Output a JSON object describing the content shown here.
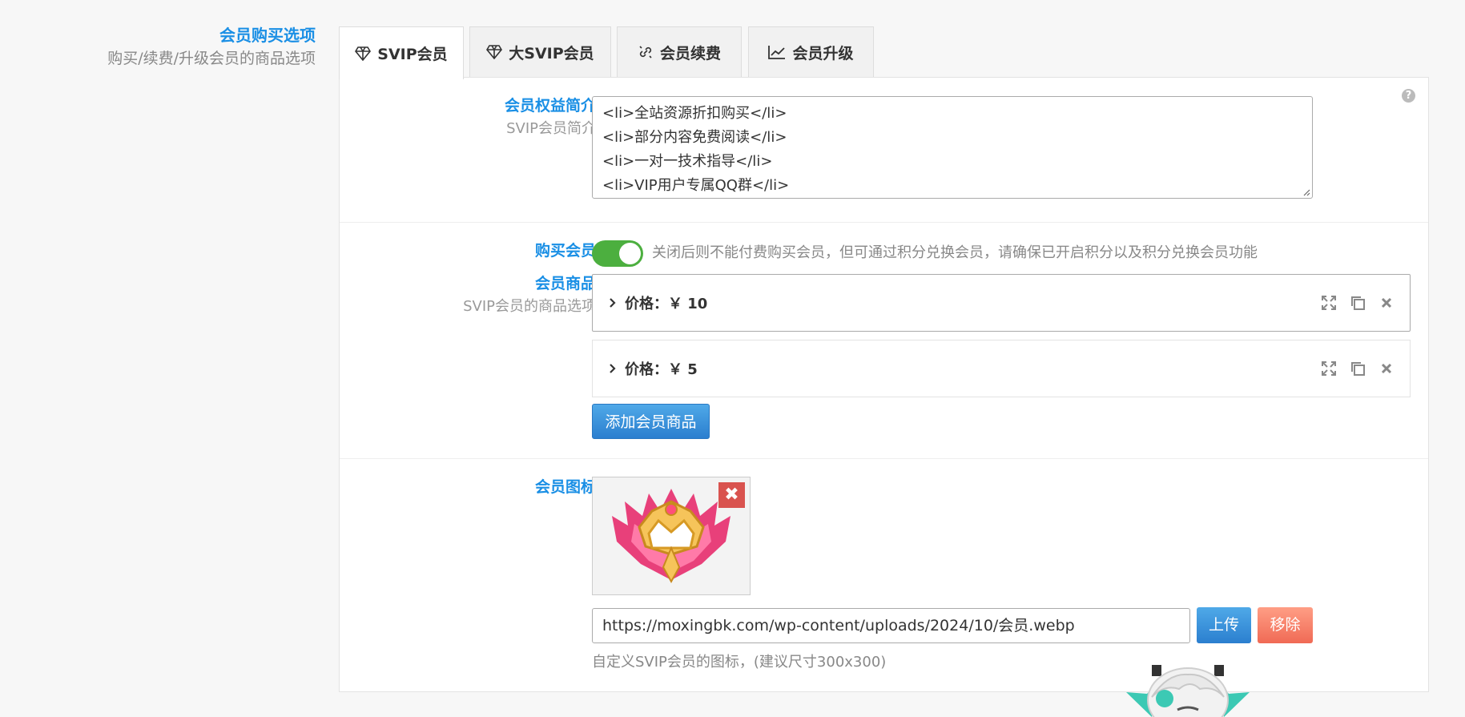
{
  "section": {
    "title": "会员购买选项",
    "subtitle": "购买/续费/升级会员的商品选项"
  },
  "tabs": [
    {
      "label": "SVIP会员",
      "icon": "diamond-icon",
      "active": true
    },
    {
      "label": "大SVIP会员",
      "icon": "diamond-icon",
      "active": false
    },
    {
      "label": "会员续费",
      "icon": "link-icon",
      "active": false
    },
    {
      "label": "会员升级",
      "icon": "chart-line-icon",
      "active": false
    }
  ],
  "benefits": {
    "label": "会员权益简介",
    "sublabel": "SVIP会员简介",
    "lines": [
      "<li>全站资源折扣购买</li>",
      "<li>部分内容免费阅读</li>",
      "<li>一对一技术指导</li>",
      "<li>VIP用户专属QQ群</li>"
    ]
  },
  "purchase": {
    "label": "购买会员",
    "enabled": true,
    "description": "关闭后则不能付费购买会员，但可通过积分兑换会员，请确保已开启积分以及积分兑换会员功能"
  },
  "products": {
    "label": "会员商品",
    "sublabel": "SVIP会员的商品选项",
    "items": [
      {
        "title": "价格：￥ 10"
      },
      {
        "title": "价格：￥ 5"
      }
    ],
    "add_label": "添加会员商品"
  },
  "icon_field": {
    "label": "会员图标",
    "url": "https://moxingbk.com/wp-content/uploads/2024/10/会员.webp",
    "upload_label": "上传",
    "remove_label": "移除",
    "hint": "自定义SVIP会员的图标，(建议尺寸300x300)"
  },
  "colors": {
    "accent": "#1a8fe5",
    "toggle_on": "#4caf3f",
    "remove_button": "#f06a55",
    "delete_badge": "#d9534f"
  }
}
